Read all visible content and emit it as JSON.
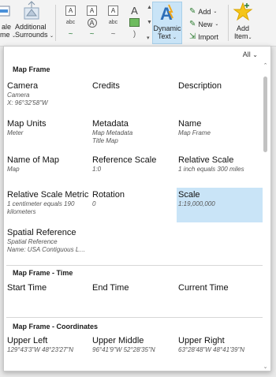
{
  "ribbon": {
    "scale_frag": "ale",
    "scale_frag2": "me",
    "additional": "Additional",
    "surrounds": "Surrounds",
    "dynamic_text": "Dynamic",
    "dynamic_text2": "Text",
    "add": "Add",
    "new": "New",
    "import": "Import",
    "add_item": "Add",
    "add_item2": "Item",
    "gallery": [
      "A",
      "A",
      "A",
      "A",
      "abc",
      "A",
      "abc",
      "",
      "~",
      "~",
      "~",
      ")"
    ]
  },
  "popup": {
    "filter": "All",
    "sections": [
      {
        "title": "Map Frame",
        "items": [
          {
            "title": "Camera",
            "subs": [
              "Camera",
              "X: 96°32'58\"W"
            ]
          },
          {
            "title": "Credits",
            "subs": []
          },
          {
            "title": "Description",
            "subs": []
          },
          {
            "title": "Map Units",
            "subs": [
              "Meter"
            ]
          },
          {
            "title": "Metadata",
            "subs": [
              "Map Metadata",
              "Title Map"
            ]
          },
          {
            "title": "Name",
            "subs": [
              "Map Frame"
            ]
          },
          {
            "title": "Name of Map",
            "subs": [
              "Map"
            ]
          },
          {
            "title": "Reference Scale",
            "subs": [
              "1:0"
            ]
          },
          {
            "title": "Relative Scale",
            "subs": [
              "1 inch equals 300 miles"
            ]
          },
          {
            "title": "Relative Scale Metric",
            "subs": [
              "1 centimeter equals 190",
              "kilometers"
            ]
          },
          {
            "title": "Rotation",
            "subs": [
              "0"
            ]
          },
          {
            "title": "Scale",
            "subs": [
              "1:19,000,000"
            ]
          },
          {
            "title": "Spatial Reference",
            "subs": [
              "Spatial Reference",
              "Name: USA Contiguous La..."
            ]
          }
        ]
      },
      {
        "title": "Map Frame - Time",
        "items": [
          {
            "title": "Start Time",
            "subs": []
          },
          {
            "title": "End Time",
            "subs": []
          },
          {
            "title": "Current Time",
            "subs": []
          }
        ]
      },
      {
        "title": "Map Frame - Coordinates",
        "items": [
          {
            "title": "Upper Left",
            "subs": [
              "129°43'3\"W 48°23'27\"N"
            ]
          },
          {
            "title": "Upper Middle",
            "subs": [
              "96°41'9\"W 52°28'35\"N"
            ]
          },
          {
            "title": "Upper Right",
            "subs": [
              "63°28'48\"W 48°41'39\"N"
            ]
          }
        ]
      }
    ]
  }
}
